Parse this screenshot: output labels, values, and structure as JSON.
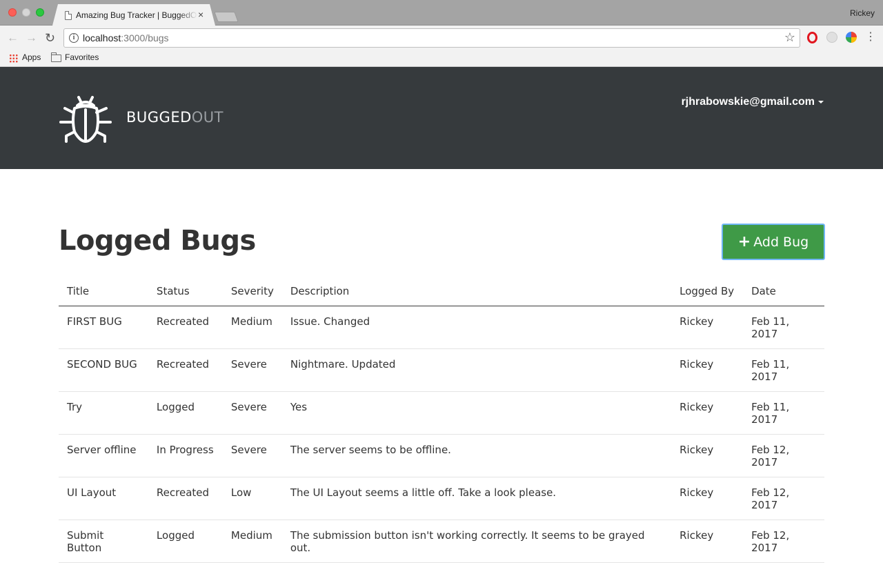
{
  "browser": {
    "tab_title": "Amazing Bug Tracker | BuggedOut",
    "tab_close": "×",
    "profile_name": "Rickey",
    "url_host": "localhost",
    "url_path": ":3000/bugs",
    "bookmarks": [
      {
        "label": "Apps",
        "icon": "apps-grid-icon"
      },
      {
        "label": "Favorites",
        "icon": "folder-icon"
      }
    ]
  },
  "header": {
    "brand_part1": "BUGGED",
    "brand_part2": "OUT",
    "user_email": "rjhrabowskie@gmail.com",
    "logo_icon": "bug-icon"
  },
  "main": {
    "title": "Logged Bugs",
    "add_button_label": "Add Bug",
    "add_button_icon": "plus-icon",
    "columns": [
      "Title",
      "Status",
      "Severity",
      "Description",
      "Logged By",
      "Date"
    ],
    "rows": [
      {
        "title": "FIRST BUG",
        "status": "Recreated",
        "severity": "Medium",
        "description": "Issue. Changed",
        "logged_by": "Rickey",
        "date": "Feb 11, 2017"
      },
      {
        "title": "SECOND BUG",
        "status": "Recreated",
        "severity": "Severe",
        "description": "Nightmare. Updated",
        "logged_by": "Rickey",
        "date": "Feb 11, 2017"
      },
      {
        "title": "Try",
        "status": "Logged",
        "severity": "Severe",
        "description": "Yes",
        "logged_by": "Rickey",
        "date": "Feb 11, 2017"
      },
      {
        "title": "Server offline",
        "status": "In Progress",
        "severity": "Severe",
        "description": "The server seems to be offline.",
        "logged_by": "Rickey",
        "date": "Feb 12, 2017"
      },
      {
        "title": "UI Layout",
        "status": "Recreated",
        "severity": "Low",
        "description": "The UI Layout seems a little off. Take a look please.",
        "logged_by": "Rickey",
        "date": "Feb 12, 2017"
      },
      {
        "title": "Submit Button",
        "status": "Logged",
        "severity": "Medium",
        "description": "The submission button isn't working correctly. It seems to be grayed out.",
        "logged_by": "Rickey",
        "date": "Feb 12, 2017"
      }
    ]
  },
  "colors": {
    "header_bg": "#363a3d",
    "add_button_bg": "#3f9a47",
    "brand_secondary": "#9a9ea2"
  }
}
